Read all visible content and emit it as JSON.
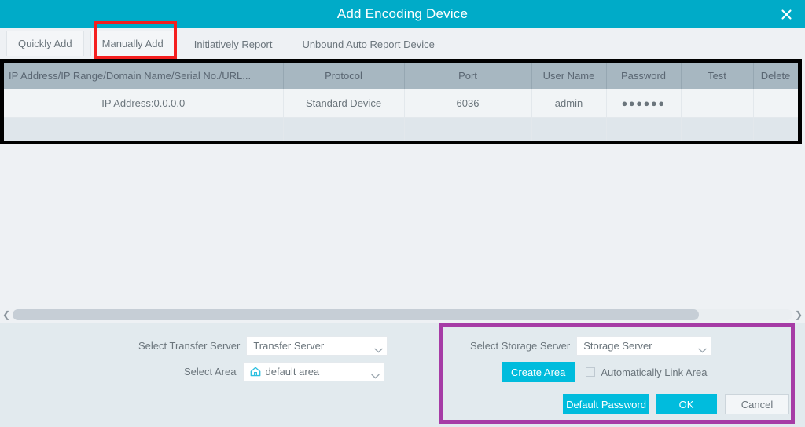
{
  "window": {
    "title": "Add  Encoding Device",
    "close_icon": "close-icon",
    "titlebar_color": "#00abc8"
  },
  "tabs": [
    {
      "label": "Quickly Add",
      "style": "boxed",
      "selected": false
    },
    {
      "label": "Manually Add",
      "style": "boxed",
      "selected": true
    },
    {
      "label": "Initiatively Report",
      "style": "plain",
      "selected": false
    },
    {
      "label": "Unbound Auto Report Device",
      "style": "plain",
      "selected": false
    }
  ],
  "annotations": [
    {
      "name": "red-highlight-manually-add",
      "color": "#f41f1f"
    },
    {
      "name": "black-highlight-device-table",
      "color": "#000000"
    },
    {
      "name": "purple-highlight-storage-panel",
      "color": "#a63ca6"
    }
  ],
  "table": {
    "columns": [
      "IP Address/IP Range/Domain Name/Serial No./URL...",
      "Protocol",
      "Port",
      "User Name",
      "Password",
      "Test",
      "Delete"
    ],
    "rows": [
      {
        "ip": "IP Address:0.0.0.0",
        "protocol": "Standard Device",
        "port": "6036",
        "username": "admin",
        "password": "●●●●●●",
        "test": "",
        "delete": ""
      },
      {
        "ip": "",
        "protocol": "",
        "port": "",
        "username": "",
        "password": "",
        "test": "",
        "delete": ""
      }
    ]
  },
  "scrollbar": {
    "left_arrow_icon": "chevron-left-icon",
    "right_arrow_icon": "chevron-right-icon"
  },
  "footer": {
    "transfer_server": {
      "label": "Select Transfer Server",
      "value": "Transfer Server",
      "chevron_icon": "chevron-down-icon"
    },
    "area": {
      "label": "Select Area",
      "value": "default area",
      "icon": "home-icon",
      "chevron_icon": "chevron-down-icon"
    },
    "storage_server": {
      "label": "Select Storage Server",
      "value": "Storage Server",
      "chevron_icon": "chevron-down-icon"
    },
    "create_area_label": "Create Area",
    "auto_link_label": "Automatically Link Area",
    "auto_link_checked": false,
    "default_password_label": "Default Password",
    "ok_label": "OK",
    "cancel_label": "Cancel"
  },
  "colors": {
    "accent": "#00abc8",
    "button": "#00bcdd",
    "header_row": "#a7b7c1",
    "footer_bg": "#e2eaee",
    "body_bg": "#eef1f4"
  }
}
